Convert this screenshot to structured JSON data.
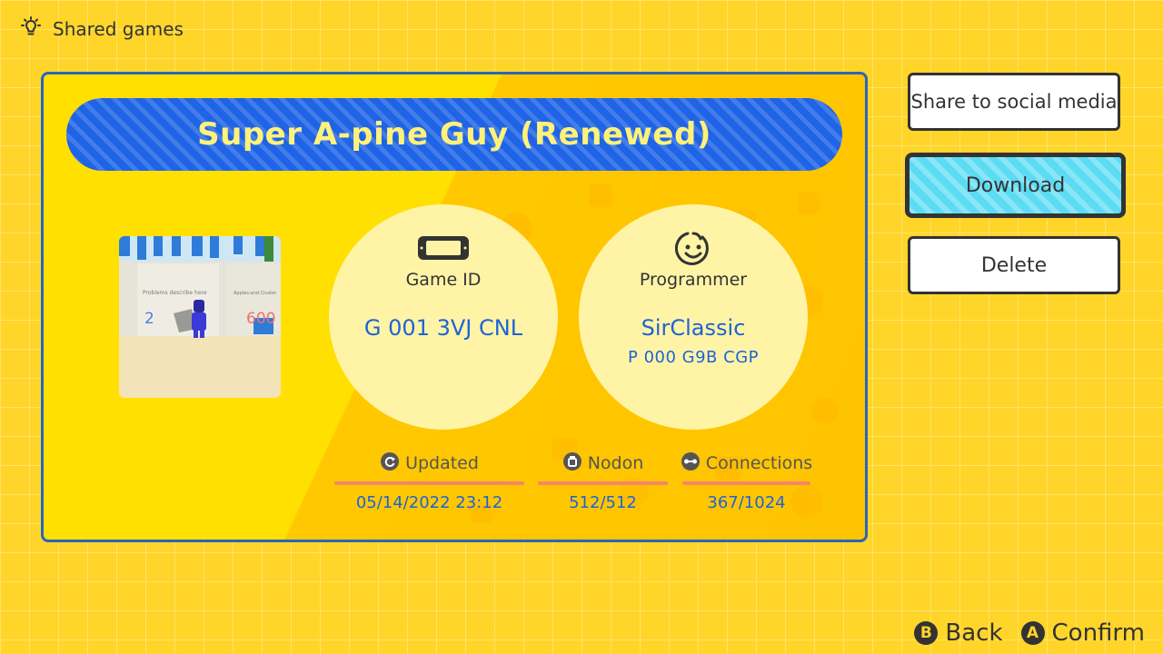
{
  "header": {
    "title": "Shared games",
    "icon": "lightbulb-icon"
  },
  "game": {
    "title": "Super A-pine Guy (Renewed)",
    "game_id_label": "Game ID",
    "game_id": "G 001 3VJ CNL",
    "programmer_label": "Programmer",
    "programmer_name": "SirClassic",
    "programmer_id": "P 000 G9B CGP"
  },
  "thumbnail": {
    "sign_left": "Problems describe here",
    "sign_right": "Apples-and Cluster",
    "score_left": "2",
    "score_right": "600"
  },
  "stats": {
    "updated_label": "Updated",
    "updated_value": "05/14/2022 23:12",
    "nodon_label": "Nodon",
    "nodon_value": "512/512",
    "connections_label": "Connections",
    "connections_value": "367/1024"
  },
  "actions": {
    "share": "Share to social media",
    "download": "Download",
    "delete": "Delete"
  },
  "footer": {
    "back_glyph": "B",
    "back_label": "Back",
    "confirm_glyph": "A",
    "confirm_label": "Confirm"
  },
  "colors": {
    "background": "#ffd52a",
    "banner": "#1f64e6",
    "title_text": "#fff27a",
    "value_text": "#1e63d6",
    "download_button": "#5bdcf4",
    "card_border": "#2a66b8"
  }
}
